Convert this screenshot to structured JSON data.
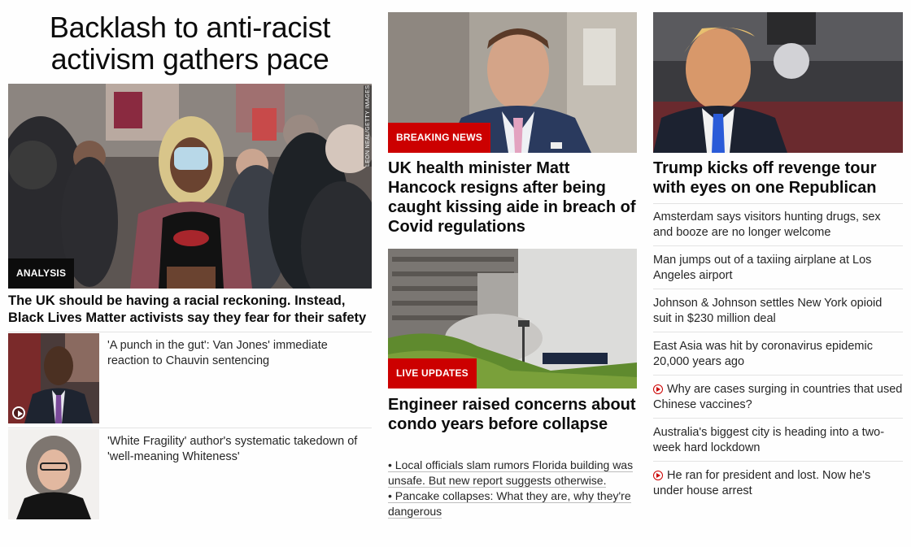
{
  "col1": {
    "section_title": "Backlash to anti-racist activism gathers pace",
    "hero": {
      "label": "ANALYSIS",
      "photo_credit": "LEON NEAL/GETTY IMAGES",
      "headline": "The UK should be having a racial reckoning. Instead, Black Lives Matter activists say they fear for their safety"
    },
    "items": [
      {
        "text": "'A punch in the gut': Van Jones' immediate reaction to Chauvin sentencing",
        "has_video": true
      },
      {
        "text": "'White Fragility' author's systematic takedown of 'well-meaning Whiteness'",
        "has_video": false
      }
    ]
  },
  "col2": {
    "story1": {
      "label": "BREAKING NEWS",
      "headline": "UK health minister Matt Hancock resigns after being caught kissing aide in breach of Covid regulations"
    },
    "story2": {
      "label": "LIVE UPDATES",
      "headline": "Engineer raised concerns about condo years before collapse",
      "bullets": [
        "• Local officials slam rumors Florida building was unsafe. But new report suggests otherwise.",
        "• Pancake collapses: What they are, why they're dangerous"
      ]
    }
  },
  "col3": {
    "headline": "Trump kicks off revenge tour with eyes on one Republican",
    "items": [
      {
        "text": "Amsterdam says visitors hunting drugs, sex and booze are no longer welcome",
        "has_video": false
      },
      {
        "text": "Man jumps out of a taxiing airplane at Los Angeles airport",
        "has_video": false
      },
      {
        "text": "Johnson & Johnson settles New York opioid suit in $230 million deal",
        "has_video": false
      },
      {
        "text": "East Asia was hit by coronavirus epidemic 20,000 years ago",
        "has_video": false
      },
      {
        "text": "Why are cases surging in countries that used Chinese vaccines?",
        "has_video": true
      },
      {
        "text": "Australia's biggest city is heading into a two-week hard lockdown",
        "has_video": false
      },
      {
        "text": "He ran for president and lost. Now he's under house arrest",
        "has_video": true
      }
    ]
  },
  "colors": {
    "breaking_red": "#cc0000",
    "label_dark": "#0c0c0c",
    "separator": "#e3e3e3",
    "text": "#262626"
  },
  "icons": {
    "video": "play-circle-icon"
  }
}
